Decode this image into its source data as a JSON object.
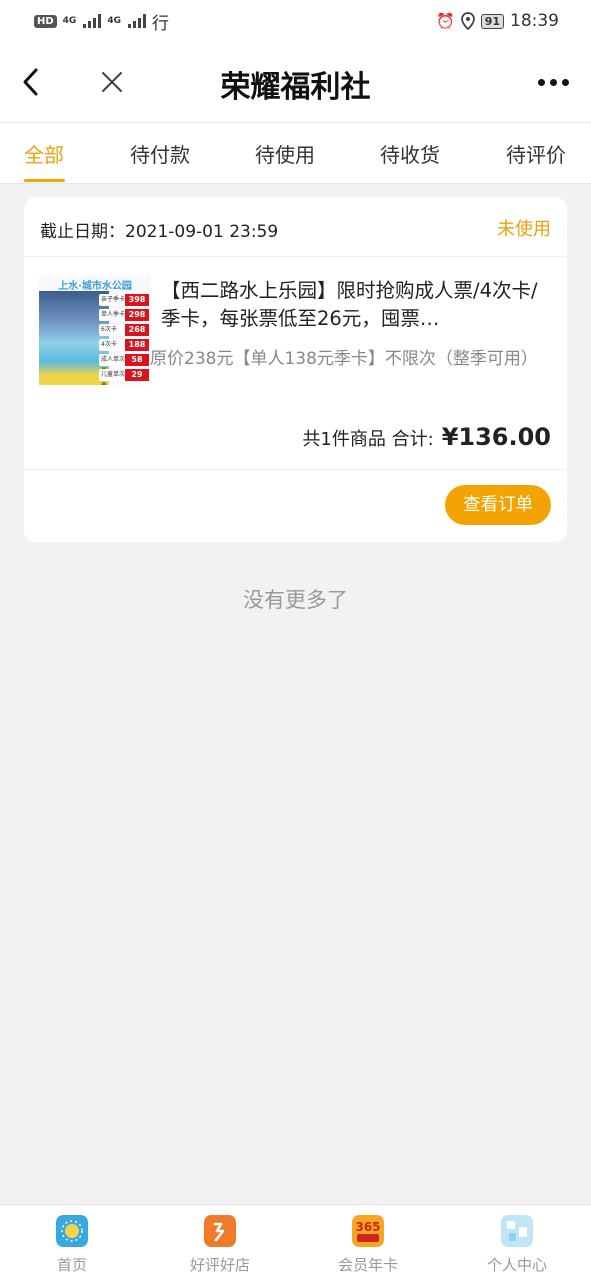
{
  "status_bar": {
    "hd_label": "HD",
    "net_label_1": "4G",
    "net_label_2": "4G",
    "carrier": "行",
    "battery": "91",
    "time": "18:39"
  },
  "nav": {
    "title": "荣耀福利社"
  },
  "tabs": [
    {
      "label": "全部",
      "active": true
    },
    {
      "label": "待付款",
      "active": false
    },
    {
      "label": "待使用",
      "active": false
    },
    {
      "label": "待收货",
      "active": false
    },
    {
      "label": "待评价",
      "active": false
    }
  ],
  "order": {
    "deadline": "截止日期：2021-09-01 23:59",
    "status": "未使用",
    "thumbnail": {
      "title": "上水·城市水公园",
      "rows": [
        {
          "label": "亲子季卡",
          "price": "398"
        },
        {
          "label": "单人季卡",
          "price": "298"
        },
        {
          "label": "6次卡",
          "price": "268"
        },
        {
          "label": "4次卡",
          "price": "188"
        },
        {
          "label": "成人单次票",
          "price": "58"
        },
        {
          "label": "儿童单次票",
          "price": "29"
        }
      ]
    },
    "title": "【西二路水上乐园】限时抢购成人票/4次卡/季卡，每张票低至26元，囤票…",
    "desc": "原价238元【单人138元季卡】不限次（整季可用）",
    "count_text": "共1件商品 合计:",
    "total": "¥136.00",
    "view_button": "查看订单"
  },
  "no_more": "没有更多了",
  "bottom_nav": [
    {
      "label": "首页",
      "icon": "home-icon",
      "color": "#3aa8e0"
    },
    {
      "label": "好评好店",
      "icon": "shop-icon",
      "color": "#f07c2a"
    },
    {
      "label": "会员年卡",
      "icon": "vip-card-icon",
      "color": "#f5a623",
      "badge": "365"
    },
    {
      "label": "个人中心",
      "icon": "user-center-icon",
      "color": "#8fd3f0"
    }
  ],
  "colors": {
    "accent": "#f0a500",
    "price_red": "#d8141c"
  }
}
